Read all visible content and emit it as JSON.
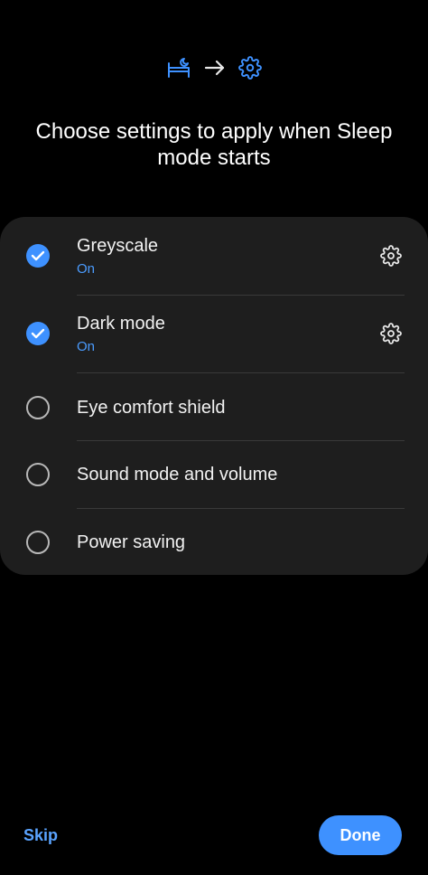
{
  "header": {
    "title": "Choose settings to apply when Sleep mode starts",
    "icons": [
      "bed-moon-icon",
      "arrow-right-icon",
      "gear-icon"
    ],
    "accent_color": "#3e91ff"
  },
  "options": [
    {
      "label": "Greyscale",
      "status": "On",
      "checked": true,
      "has_settings": true
    },
    {
      "label": "Dark mode",
      "status": "On",
      "checked": true,
      "has_settings": true
    },
    {
      "label": "Eye comfort shield",
      "checked": false,
      "has_settings": false
    },
    {
      "label": "Sound mode and volume",
      "checked": false,
      "has_settings": false
    },
    {
      "label": "Power saving",
      "checked": false,
      "has_settings": false
    }
  ],
  "footer": {
    "skip_label": "Skip",
    "done_label": "Done"
  }
}
